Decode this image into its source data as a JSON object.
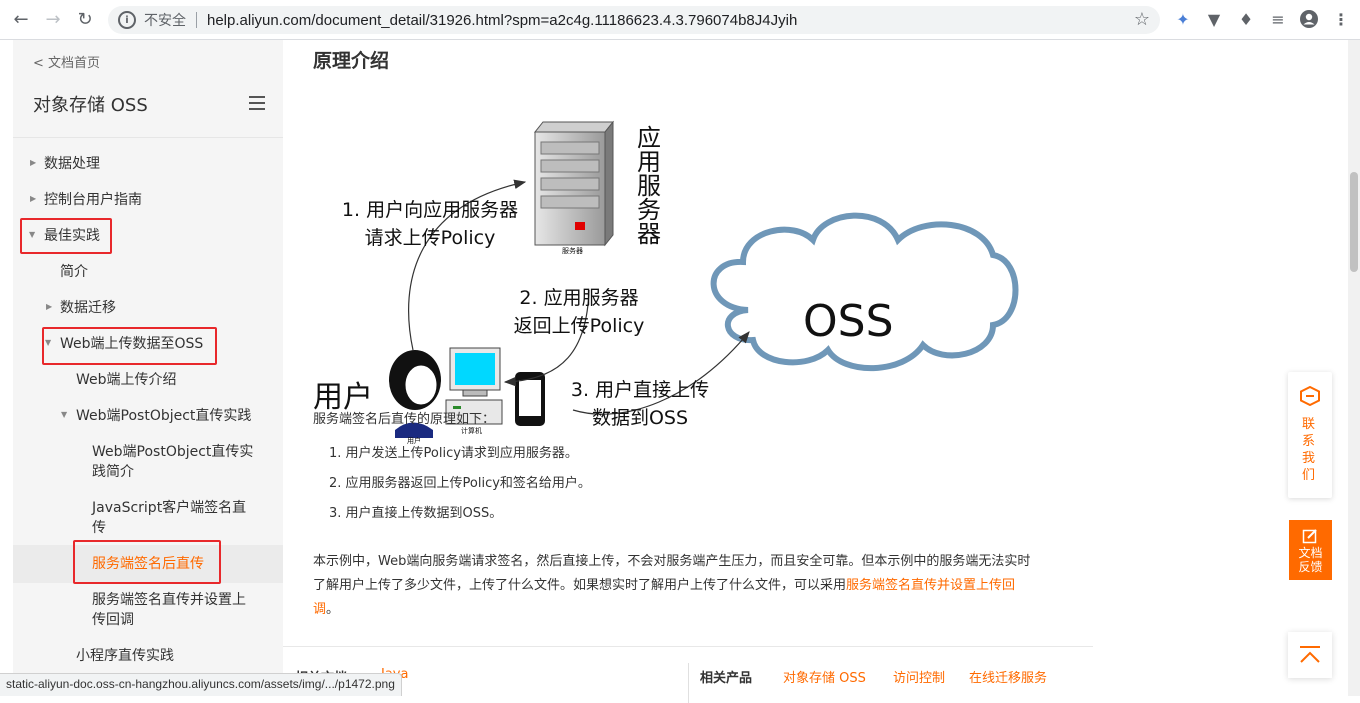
{
  "browser": {
    "insecure_label": "不安全",
    "url": "help.aliyun.com/document_detail/31926.html?spm=a2c4g.11186623.4.3.796074b8J4Jyih",
    "status_url": "static-aliyun-doc.oss-cn-hangzhou.aliyuncs.com/assets/img/.../p1472.png"
  },
  "sidebar": {
    "back_link": "< 文档首页",
    "title": "对象存储 OSS",
    "items": [
      {
        "label": "数据处理"
      },
      {
        "label": "控制台用户指南"
      },
      {
        "label": "最佳实践"
      },
      {
        "label": "简介"
      },
      {
        "label": "数据迁移"
      },
      {
        "label": "Web端上传数据至OSS"
      },
      {
        "label": "Web端上传介绍"
      },
      {
        "label": "Web端PostObject直传实践"
      },
      {
        "label_line1": "Web端PostObject直传实",
        "label_line2": "践简介"
      },
      {
        "label_line1": "JavaScript客户端签名直",
        "label_line2": "传"
      },
      {
        "label": "服务端签名后直传"
      },
      {
        "label_line1": "服务端签名直传并设置上",
        "label_line2": "传回调"
      },
      {
        "label": "小程序直传实践"
      }
    ]
  },
  "main": {
    "heading": "原理介绍",
    "diagram": {
      "app_server_label": "应用服务器",
      "server_caption": "服务器",
      "step1_line1": "1. 用户向应用服务器",
      "step1_line2": "请求上传Policy",
      "step2_line1": "2. 应用服务器",
      "step2_line2": "返回上传Policy",
      "oss_label": "OSS",
      "user_label": "用户",
      "user_caption": "用户",
      "computer_caption": "计算机",
      "step3_line1": "3. 用户直接上传",
      "step3_line2": "数据到OSS"
    },
    "intro": "服务端签名后直传的原理如下：",
    "steps": [
      "1. 用户发送上传Policy请求到应用服务器。",
      "2. 应用服务器返回上传Policy和签名给用户。",
      "3. 用户直接上传数据到OSS。"
    ],
    "para_line1": "本示例中，Web端向服务端请求签名，然后直接上传，不会对服务端产生压力，而且安全可靠。但本示例中的服务端无法实时",
    "para_line2": "了解用户上传了多少文件，上传了什么文件。如果想实时了解用户上传了什么文件，可以采用",
    "para_link": "服务端签名直传并设置上传回",
    "para_link2": "调",
    "para_end": "。"
  },
  "related": {
    "docs_label": "相关文档",
    "docs_link": "Java",
    "products_label": "相关产品",
    "products": [
      "对象存储 OSS",
      "访问控制",
      "在线迁移服务"
    ]
  },
  "widgets": {
    "contact": "联系我们",
    "feedback_line1": "文档",
    "feedback_line2": "反馈"
  },
  "colors": {
    "accent": "#ff6a00",
    "highlight_box": "#e8282b"
  }
}
